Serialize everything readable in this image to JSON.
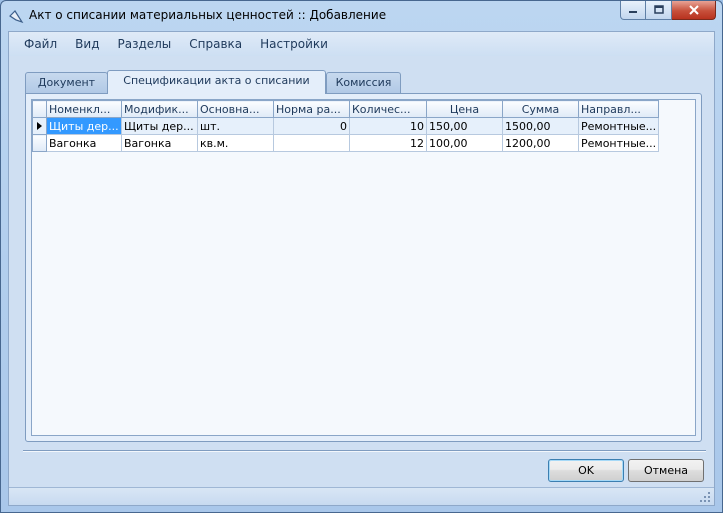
{
  "window": {
    "title": "Акт о списании материальных ценностей :: Добавление"
  },
  "menu": {
    "items": [
      {
        "label": "Файл"
      },
      {
        "label": "Вид"
      },
      {
        "label": "Разделы"
      },
      {
        "label": "Справка"
      },
      {
        "label": "Настройки"
      }
    ]
  },
  "tabs": [
    {
      "label": "Документ",
      "active": false
    },
    {
      "label": "Спецификации акта о списании",
      "active": true
    },
    {
      "label": "Комиссия",
      "active": false
    }
  ],
  "grid": {
    "columns": [
      "Номенкл...",
      "Модифик...",
      "Основна...",
      "Норма ра...",
      "Количес...",
      "Цена",
      "Сумма",
      "Направл..."
    ],
    "rows": [
      [
        "Щиты дер...",
        "Щиты дер...",
        "шт.",
        "0",
        "10",
        "150,00",
        "1500,00",
        "Ремонтные..."
      ],
      [
        "Вагонка",
        "Вагонка",
        "кв.м.",
        "",
        "12",
        "100,00",
        "1200,00",
        "Ремонтные..."
      ]
    ],
    "current_row": 0,
    "selection_color": "#3399ff"
  },
  "buttons": {
    "ok": "OK",
    "cancel": "Отмена"
  },
  "icons": {
    "app": "app-icon",
    "minimize": "minimize-icon",
    "maximize": "maximize-icon",
    "close": "close-icon",
    "row_pointer": "row-pointer-icon",
    "size_grip": "size-grip-icon"
  }
}
